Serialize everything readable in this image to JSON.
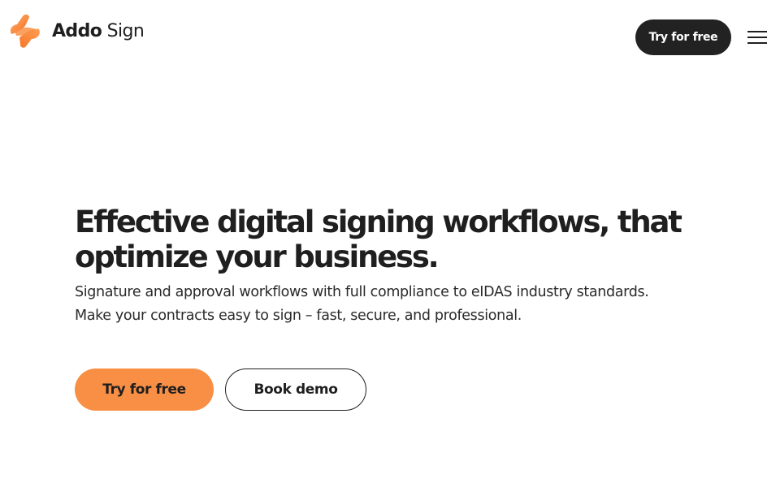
{
  "brand": {
    "name_primary": "Addo",
    "name_secondary": "Sign",
    "accent_color": "#f98f45",
    "logo_icon": "addo-logo-icon"
  },
  "header": {
    "cta_label": "Try for free",
    "menu_icon": "hamburger-menu-icon"
  },
  "hero": {
    "title": "Effective digital signing workflows, that optimize your business.",
    "subtitle": "Signature and approval workflows with full compliance to eIDAS industry standards. Make your contracts easy to sign – fast, secure, and professional.",
    "primary_cta": "Try for free",
    "secondary_cta": "Book demo"
  },
  "colors": {
    "dark_button": "#222222",
    "text": "#1f1f1f",
    "background": "#ffffff"
  }
}
